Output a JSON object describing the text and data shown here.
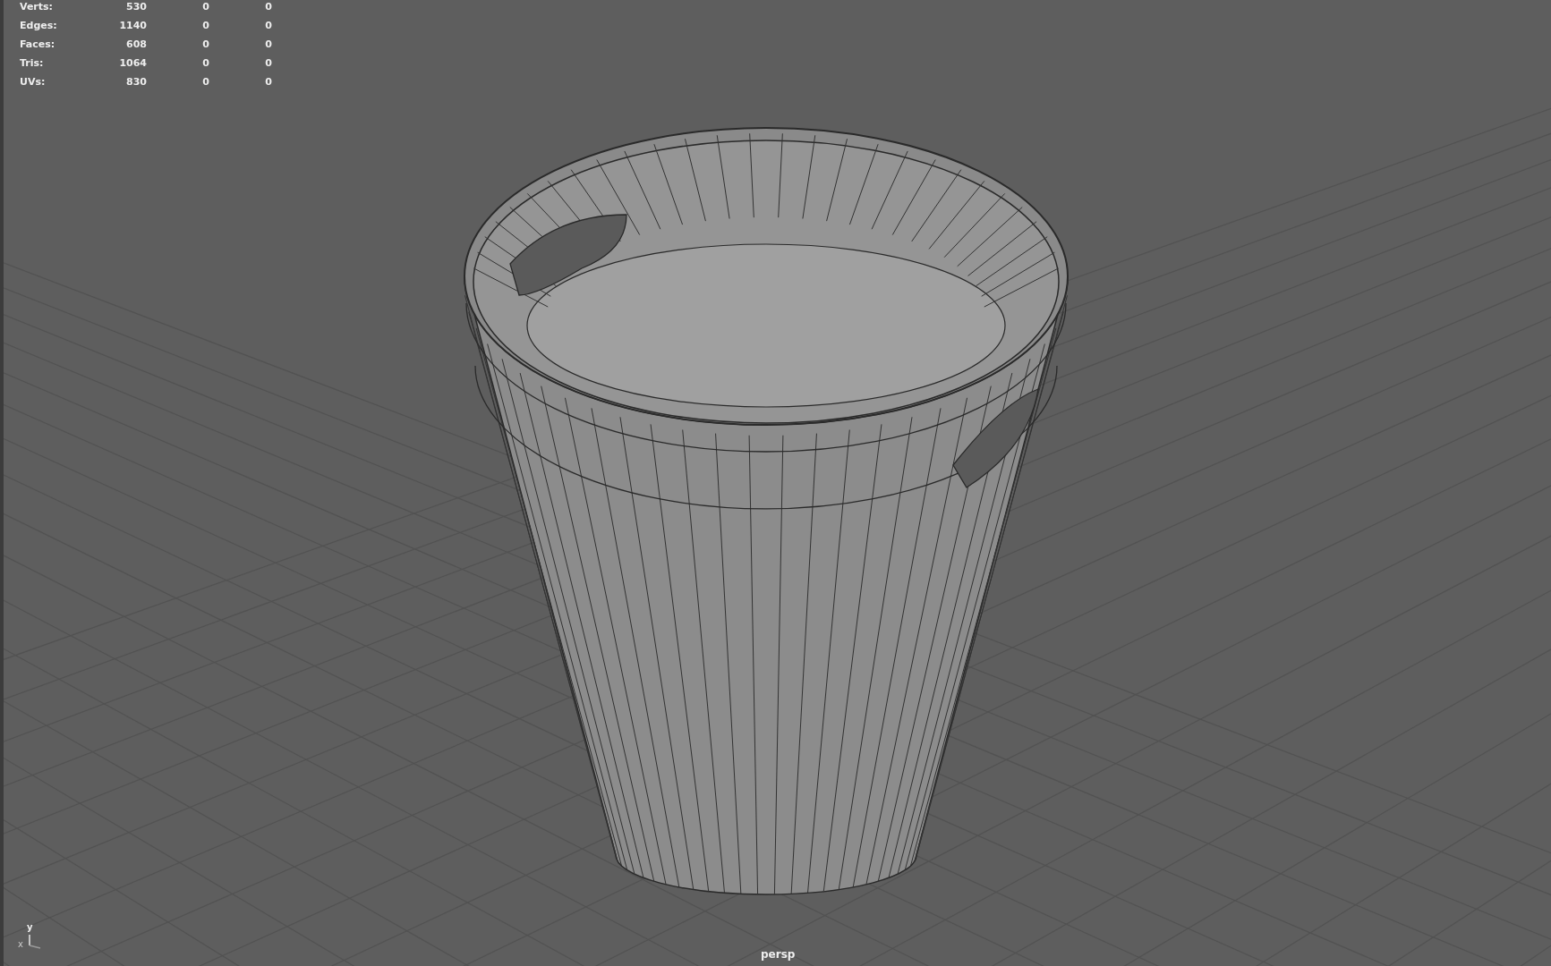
{
  "heads_up_display": {
    "rows": [
      {
        "label": "Verts:",
        "values": [
          "530",
          "0",
          "0"
        ]
      },
      {
        "label": "Edges:",
        "values": [
          "1140",
          "0",
          "0"
        ]
      },
      {
        "label": "Faces:",
        "values": [
          "608",
          "0",
          "0"
        ]
      },
      {
        "label": "Tris:",
        "values": [
          "1064",
          "0",
          "0"
        ]
      },
      {
        "label": "UVs:",
        "values": [
          "830",
          "0",
          "0"
        ]
      }
    ]
  },
  "axis_indicator": {
    "up_label": "y",
    "side_label": "x"
  },
  "viewport": {
    "camera": "persp"
  }
}
